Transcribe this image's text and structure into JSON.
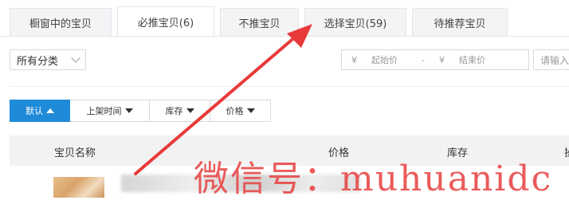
{
  "tabs": [
    {
      "label": "橱窗中的宝贝"
    },
    {
      "label": "必推宝贝(6)"
    },
    {
      "label": "不推宝贝"
    },
    {
      "label": "选择宝贝(59)"
    },
    {
      "label": "待推荐宝贝"
    }
  ],
  "filters": {
    "category": "所有分类",
    "currency_symbol": "¥",
    "min_price_placeholder": "起始价",
    "range_dash": "-",
    "max_price_placeholder": "结束价",
    "search_placeholder": "请输入"
  },
  "sort": [
    {
      "label": "默认"
    },
    {
      "label": "上架时间"
    },
    {
      "label": "库存"
    },
    {
      "label": "价格"
    }
  ],
  "table": {
    "columns": [
      "宝贝名称",
      "价格",
      "库存",
      "操"
    ]
  },
  "watermark": "微信号：muhuanidc",
  "colors": {
    "accent": "#1f8ad8",
    "arrow": "#e83a3a"
  }
}
